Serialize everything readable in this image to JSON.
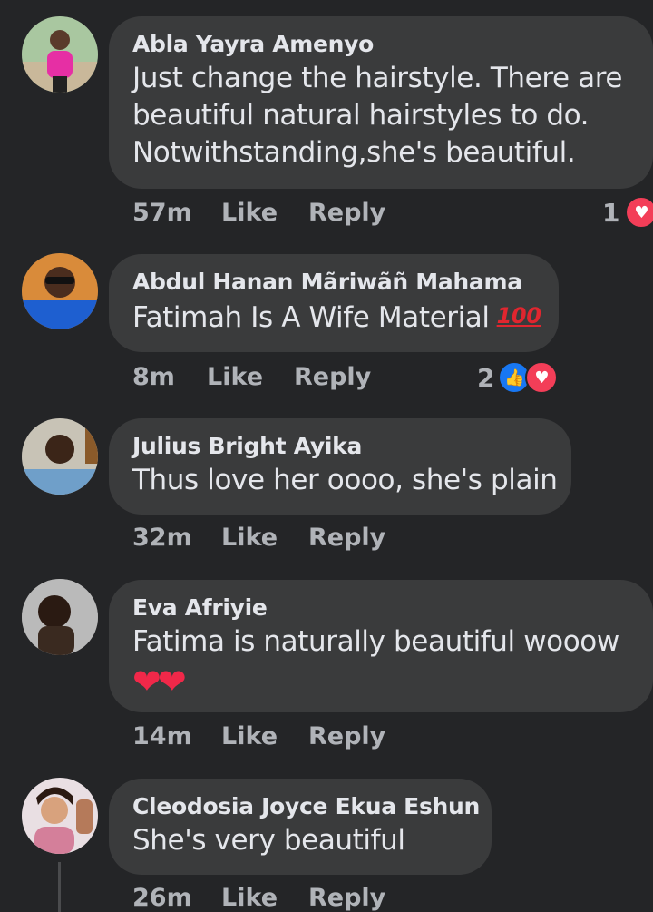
{
  "comments": [
    {
      "author": "Abla Yayra Amenyo",
      "lines": [
        "Just change the hairstyle. There are",
        "beautiful natural hairstyles to do.",
        "Notwithstanding,she's beautiful."
      ],
      "time": "57m",
      "like_label": "Like",
      "reply_label": "Reply",
      "reaction_count": "1",
      "reactions": [
        "love-icon"
      ]
    },
    {
      "author": "Abdul Hanan Mãriwãñ Mahama",
      "lines": [
        "Fatimah Is A Wife Material"
      ],
      "emoji": "100",
      "time": "8m",
      "like_label": "Like",
      "reply_label": "Reply",
      "reaction_count": "2",
      "reactions": [
        "like-icon",
        "love-icon"
      ]
    },
    {
      "author": "Julius Bright Ayika",
      "lines": [
        "Thus love her oooo, she's plain"
      ],
      "time": "32m",
      "like_label": "Like",
      "reply_label": "Reply"
    },
    {
      "author": "Eva Afriyie",
      "lines": [
        "Fatima is naturally beautiful wooow",
        "❤❤"
      ],
      "time": "14m",
      "like_label": "Like",
      "reply_label": "Reply"
    },
    {
      "author": "Cleodosia Joyce Ekua Eshun",
      "lines": [
        "She's very beautiful"
      ],
      "time": "26m",
      "like_label": "Like",
      "reply_label": "Reply"
    }
  ],
  "colors": {
    "background": "#242527",
    "bubble": "#3a3b3c",
    "text": "#e4e6eb",
    "meta": "#b0b3b8",
    "love": "#f33e58",
    "like": "#1877f2"
  }
}
